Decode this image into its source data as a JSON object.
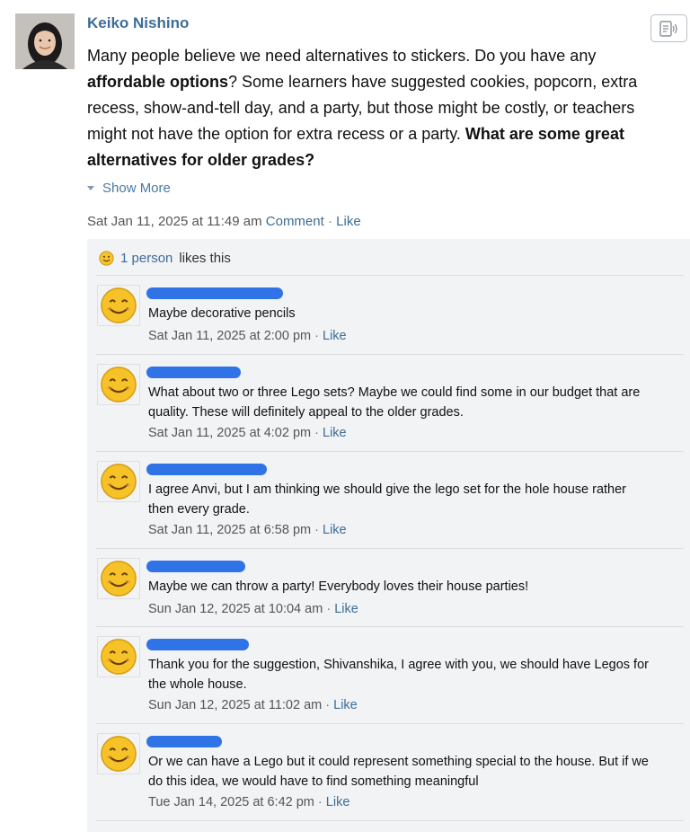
{
  "post": {
    "author": "Keiko Nishino",
    "body_parts": {
      "p1": "Many people believe we need alternatives to stickers. Do you have any ",
      "b1": "affordable options",
      "p2": "? Some learners have suggested cookies, popcorn, extra recess, show-and-tell day, and a party, but those might be costly, or teachers might not have the option for extra recess or a party. ",
      "b2": "What are some great alternatives for older grades?"
    },
    "show_more": "Show More",
    "timestamp": "Sat Jan 11, 2025 at 11:49 am",
    "comment_label": "Comment",
    "like_label": "Like",
    "separator": "·"
  },
  "likes": {
    "count_link": "1 person",
    "suffix": "likes this"
  },
  "comments": [
    {
      "text": "Maybe decorative pencils",
      "timestamp": "Sat Jan 11, 2025 at 2:00 pm",
      "like_label": "Like"
    },
    {
      "text": "What about two or three Lego sets? Maybe we could find some in our budget that are quality. These will definitely appeal to the older grades.",
      "timestamp": "Sat Jan 11, 2025 at 4:02 pm",
      "like_label": "Like"
    },
    {
      "text": "I agree Anvi, but I am thinking we should give the lego set for the hole house rather then every grade.",
      "timestamp": "Sat Jan 11, 2025 at 6:58 pm",
      "like_label": "Like"
    },
    {
      "text": "Maybe we can throw a party! Everybody loves their house parties!",
      "timestamp": "Sun Jan 12, 2025 at 10:04 am",
      "like_label": "Like"
    },
    {
      "text": "Thank you for the suggestion, Shivanshika, I agree with you, we should have Legos for the whole house.",
      "timestamp": "Sun Jan 12, 2025 at 11:02 am",
      "like_label": "Like"
    },
    {
      "text": "Or we can have a Lego but it could represent something special to the house. But if we do this idea, we would have to find something meaningful",
      "timestamp": "Tue Jan 14, 2025 at 6:42 pm",
      "like_label": "Like"
    }
  ],
  "colors": {
    "link": "#3d6d96",
    "redaction": "#2f73e6",
    "panel_background": "#f2f3f5"
  },
  "icons": {
    "author_avatar": "author-photo",
    "speak": "text-to-speech-icon",
    "commenter_avatar": "smiley-face-icon",
    "like_reaction": "smiley-reaction-icon"
  }
}
